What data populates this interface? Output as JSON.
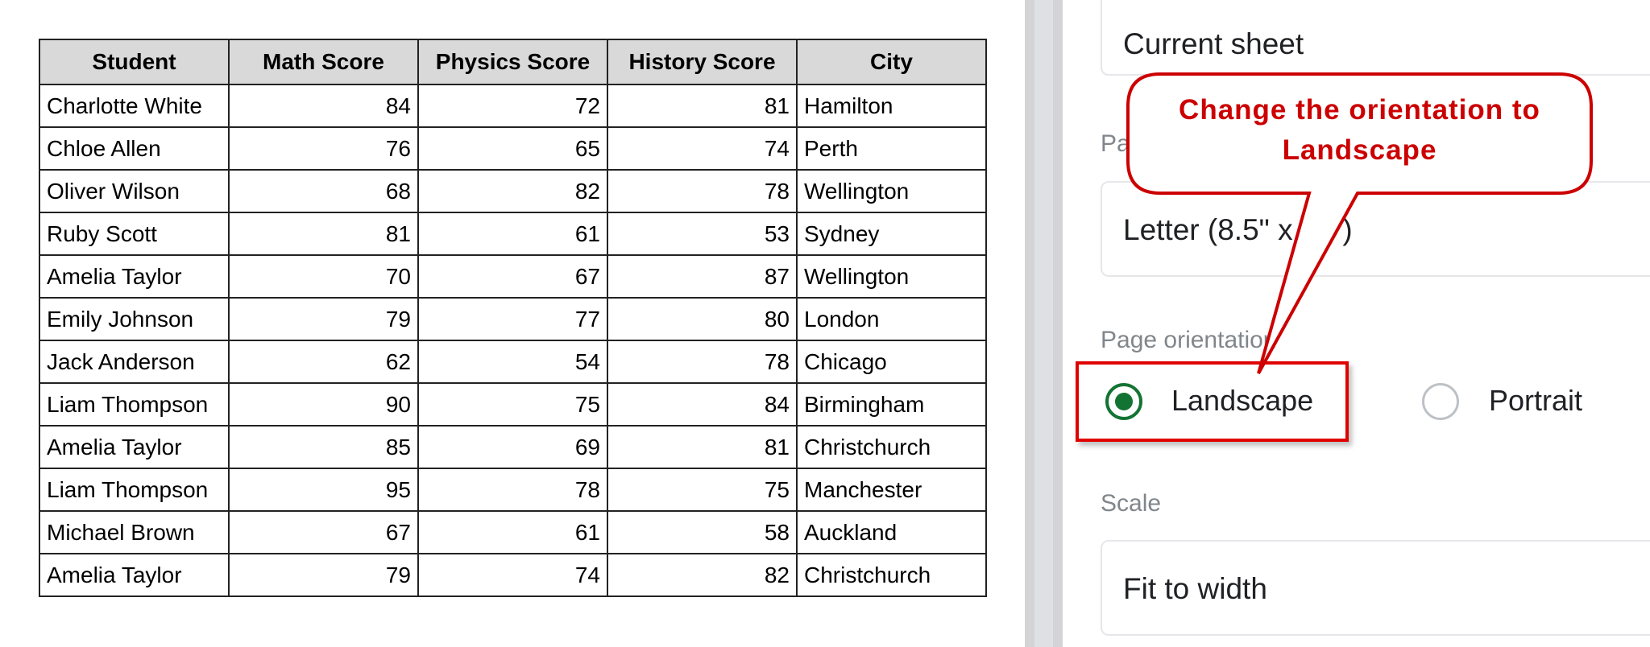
{
  "table": {
    "headers": [
      "Student",
      "Math Score",
      "Physics Score",
      "History Score",
      "City"
    ],
    "rows": [
      [
        "Charlotte White",
        "84",
        "72",
        "81",
        "Hamilton"
      ],
      [
        "Chloe Allen",
        "76",
        "65",
        "74",
        "Perth"
      ],
      [
        "Oliver Wilson",
        "68",
        "82",
        "78",
        "Wellington"
      ],
      [
        "Ruby Scott",
        "81",
        "61",
        "53",
        "Sydney"
      ],
      [
        "Amelia Taylor",
        "70",
        "67",
        "87",
        "Wellington"
      ],
      [
        "Emily Johnson",
        "79",
        "77",
        "80",
        "London"
      ],
      [
        "Jack Anderson",
        "62",
        "54",
        "78",
        "Chicago"
      ],
      [
        "Liam Thompson",
        "90",
        "75",
        "84",
        "Birmingham"
      ],
      [
        "Amelia Taylor",
        "85",
        "69",
        "81",
        "Christchurch"
      ],
      [
        "Liam Thompson",
        "95",
        "78",
        "75",
        "Manchester"
      ],
      [
        "Michael Brown",
        "67",
        "61",
        "58",
        "Auckland"
      ],
      [
        "Amelia Taylor",
        "79",
        "74",
        "82",
        "Christchurch"
      ]
    ]
  },
  "print_panel": {
    "print_range_value": "Current sheet",
    "paper_size_label": "Pa",
    "paper_size_value": "Letter (8.5\" x 11\")",
    "orientation_label": "Page orientation",
    "orientation_options": [
      "Landscape",
      "Portrait"
    ],
    "orientation_selected": "Landscape",
    "scale_label": "Scale",
    "scale_value": "Fit to width"
  },
  "annotation": {
    "line1": "Change the orientation to",
    "line2": "Landscape",
    "color": "#cc0000"
  },
  "colors": {
    "accent_green": "#137333",
    "highlight_red": "#e00000"
  }
}
